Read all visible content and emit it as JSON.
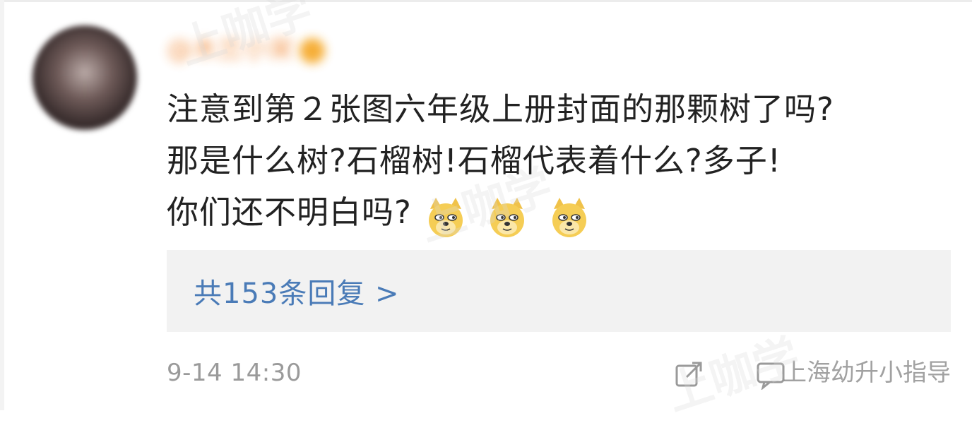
{
  "comment": {
    "username": "@木兰小宋",
    "lines": [
      "注意到第２张图六年级上册封面的那颗树了吗?",
      "那是什么树?石榴树!石榴代表着什么?多子!",
      "你们还不明白吗?"
    ],
    "emoji_count": 3,
    "replies_label": "共153条回复 >",
    "timestamp": "9-14 14:30"
  },
  "watermark": {
    "source_text": "上海幼升小指导",
    "overlay_text": "上咖学"
  },
  "icons": {
    "avatar": "avatar",
    "share": "share-icon",
    "comment": "comment-icon",
    "emoji": "doge-emoji-icon"
  },
  "colors": {
    "text": "#222222",
    "link": "#4a7bb7",
    "muted": "#9a9a9a",
    "reply_bg": "#f2f2f2"
  }
}
